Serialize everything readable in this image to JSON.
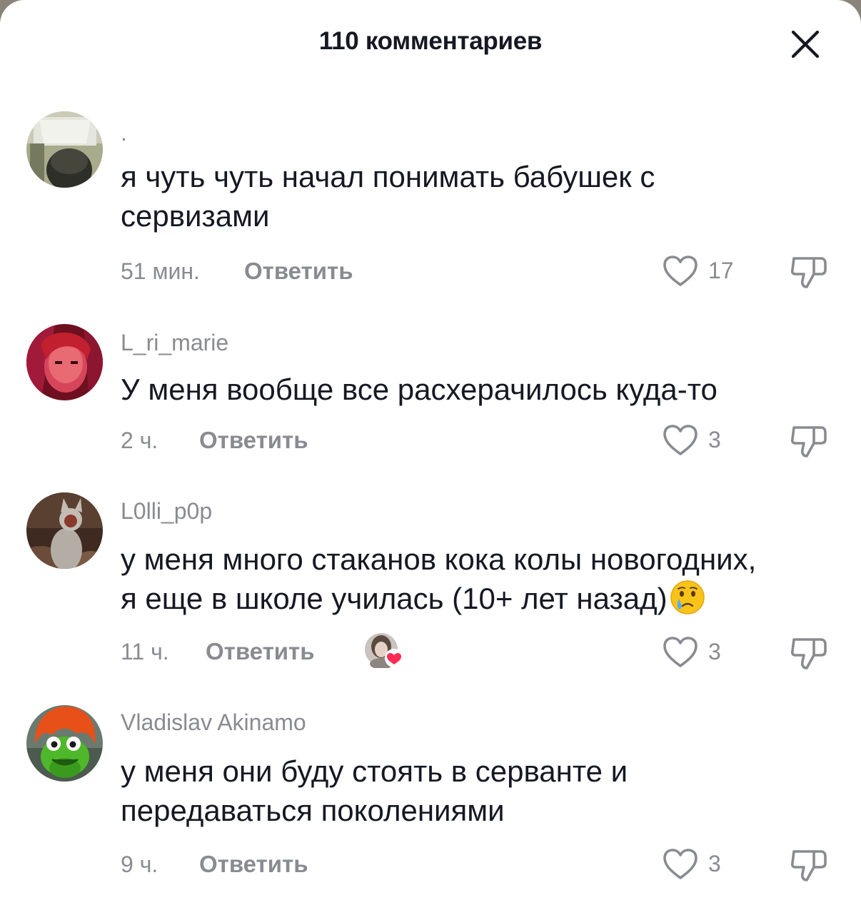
{
  "header": {
    "title": "110 комментариев"
  },
  "comments": [
    {
      "username": ".",
      "text": "я чуть чуть начал понимать бабушек с\nсервизами",
      "time": "51 мин.",
      "reply_label": "Ответить",
      "likes": "17"
    },
    {
      "username": "L_ri_marie",
      "text": "У меня вообще все расхерачилось куда-то",
      "time": "2 ч.",
      "reply_label": "Ответить",
      "likes": "3"
    },
    {
      "username": "L0lli_p0p",
      "text": "у меня много стаканов кока колы новогодних,\nя еще в школе училась (10+ лет назад)",
      "emoji": "crying-face-emoji",
      "time": "11 ч.",
      "reply_label": "Ответить",
      "likes": "3",
      "liked_by_creator": true
    },
    {
      "username": "Vladislav Akinamo",
      "text": "у меня они буду стоять в серванте и\nпередаваться поколениями",
      "time": "9 ч.",
      "reply_label": "Ответить",
      "likes": "3"
    }
  ],
  "colors": {
    "primary_text": "#161823",
    "secondary_text": "#8a8b91",
    "heart_badge": "#fe2c55",
    "background": "#ffffff"
  }
}
